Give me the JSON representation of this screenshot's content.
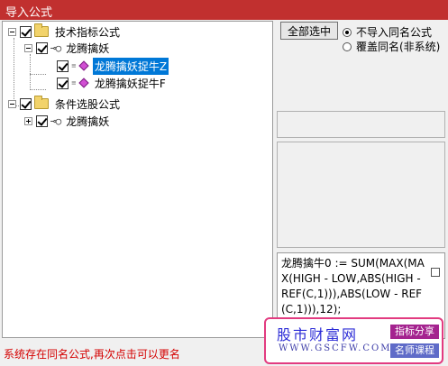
{
  "window": {
    "title": "导入公式"
  },
  "tree": {
    "nodes": [
      {
        "label": "技术指标公式"
      },
      {
        "label": "龙腾擒妖"
      },
      {
        "label": "龙腾擒妖捉牛Z"
      },
      {
        "label": "龙腾擒妖捉牛F"
      },
      {
        "label": "条件选股公式"
      },
      {
        "label": "龙腾擒妖"
      }
    ]
  },
  "panel": {
    "select_all_label": "全部选中",
    "options": [
      {
        "label": "不导入同名公式",
        "selected": true
      },
      {
        "label": "覆盖同名(非系统)",
        "selected": false
      }
    ],
    "formula_text": "龙腾擒牛0 := SUM(MAX(MAX(HIGH - LOW,ABS(HIGH - REF(C,1))),ABS(LOW - REF(C,1))),12);"
  },
  "status_text": "系统存在同名公式,再次点击可以更名",
  "watermark": {
    "main": "股市财富网",
    "url": "WWW.GSCFW.COM",
    "tag1": "指标分享",
    "tag2": "名师课程"
  },
  "colors": {
    "titlebar": "#c1302f",
    "selection": "#0078d7",
    "status": "#d40000",
    "watermark_border": "#e23b80"
  }
}
